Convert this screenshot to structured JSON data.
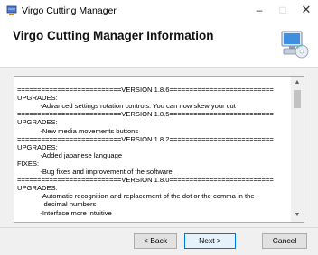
{
  "window": {
    "title": "Virgo Cutting Manager",
    "controls": {
      "minimize": "–",
      "maximize": "□",
      "close": "✕"
    }
  },
  "header": {
    "title": "Virgo Cutting Manager Information",
    "logo_icon": "computer-cd-icon"
  },
  "release_notes": [
    "==========================VERSION 1.8.6==========================",
    "UPGRADES:",
    "            -Advanced settings rotation controls. You can now skew your cut",
    "==========================VERSION 1.8.5==========================",
    "UPGRADES:",
    "            -New media movements buttons",
    "==========================VERSION 1.8.2==========================",
    "UPGRADES:",
    "            -Added japanese language",
    "FIXES:",
    "            -Bug fixes and improvement of the software",
    "==========================VERSION 1.8.0==========================",
    "UPGRADES:",
    "            -Automatic recognition and replacement of the dot or the comma in the",
    "              decimal numbers",
    "            -Interface more intuitive"
  ],
  "buttons": {
    "back": "< Back",
    "next": "Next >",
    "cancel": "Cancel"
  }
}
